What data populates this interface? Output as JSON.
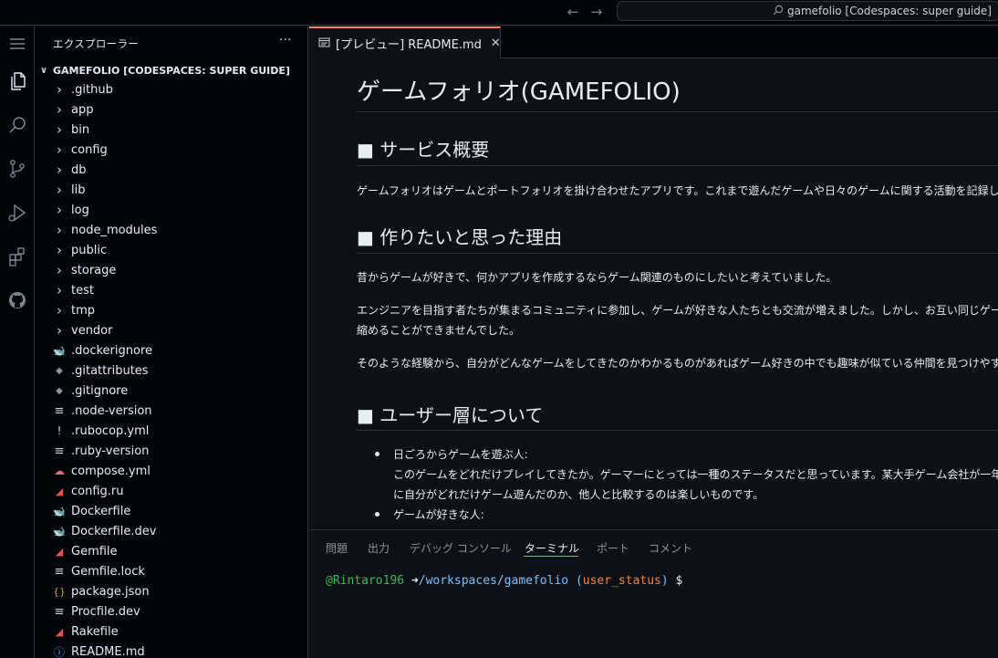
{
  "titlebar": {
    "back_icon": "arrow-left-icon",
    "forward_icon": "arrow-right-icon",
    "command_center": "gamefolio [Codespaces: super guide]"
  },
  "activitybar": {
    "items": [
      "explorer-icon",
      "search-icon",
      "source-control-icon",
      "run-debug-icon",
      "extensions-icon",
      "github-icon"
    ]
  },
  "sidebar": {
    "title": "エクスプローラー",
    "more": "···",
    "root": "GAMEFOLIO [CODESPACES: SUPER GUIDE]",
    "items": [
      {
        "name": ".github",
        "icon": ">"
      },
      {
        "name": "app",
        "icon": ">"
      },
      {
        "name": "bin",
        "icon": ">"
      },
      {
        "name": "config",
        "icon": ">"
      },
      {
        "name": "db",
        "icon": ">"
      },
      {
        "name": "lib",
        "icon": ">"
      },
      {
        "name": "log",
        "icon": ">"
      },
      {
        "name": "node_modules",
        "icon": ">"
      },
      {
        "name": "public",
        "icon": ">"
      },
      {
        "name": "storage",
        "icon": ">"
      },
      {
        "name": "test",
        "icon": ">"
      },
      {
        "name": "tmp",
        "icon": ">"
      },
      {
        "name": "vendor",
        "icon": ">"
      },
      {
        "name": ".dockerignore",
        "icon": "docker"
      },
      {
        "name": ".gitattributes",
        "icon": "git"
      },
      {
        "name": ".gitignore",
        "icon": "git"
      },
      {
        "name": ".node-version",
        "icon": "lines"
      },
      {
        "name": ".rubocop.yml",
        "icon": "!"
      },
      {
        "name": ".ruby-version",
        "icon": "lines"
      },
      {
        "name": "compose.yml",
        "icon": "compose"
      },
      {
        "name": "config.ru",
        "icon": "ruby"
      },
      {
        "name": "Dockerfile",
        "icon": "docker"
      },
      {
        "name": "Dockerfile.dev",
        "icon": "docker"
      },
      {
        "name": "Gemfile",
        "icon": "ruby"
      },
      {
        "name": "Gemfile.lock",
        "icon": "lines"
      },
      {
        "name": "package.json",
        "icon": "{}"
      },
      {
        "name": "Procfile.dev",
        "icon": "lines"
      },
      {
        "name": "Rakefile",
        "icon": "ruby"
      },
      {
        "name": "README.md",
        "icon": "info"
      }
    ]
  },
  "editor": {
    "tab_label": "[プレビュー] README.md",
    "tab_icon": "preview-icon",
    "tab_close": "✕",
    "preview": {
      "h1": "ゲームフォリオ(GAMEFOLIO)",
      "section1_title": "■ サービス概要",
      "section1_p": "ゲームフォリオはゲームとポートフォリオを掛け合わせたアプリです。これまで遊んだゲームや日々のゲームに関する活動を記録していくこと",
      "section2_title": "■ 作りたいと思った理由",
      "section2_p1": "昔からゲームが好きで、何かアプリを作成するならゲーム関連のものにしたいと考えていました。",
      "section2_p2_line1": "エンジニアを目指す者たちが集まるコミュニティに参加し、ゲームが好きな人たちとも交流が増えました。しかし、お互い同じゲームをプレ",
      "section2_p2_line2": "縮めることができませんでした。",
      "section2_p3": "そのような経験から、自分がどんなゲームをしてきたのかわかるものがあればゲーム好きの中でも趣味が似ている仲間を見つけやすくなる",
      "section3_title": "■ ユーザー層について",
      "li1_title": "日ごろからゲームを遊ぶ人:",
      "li1_line1": "このゲームをどれだけプレイしてきたか。ゲーマーにとっては一種のステータスだと思っています。某大手ゲーム会社が一年間最も遊",
      "li1_line2": "に自分がどれだけゲーム遊んだのか、他人と比較するのは楽しいものです。",
      "li2_title": "ゲームが好きな人:"
    }
  },
  "panel": {
    "tabs": [
      "問題",
      "出力",
      "デバッグ コンソール",
      "ターミナル",
      "ポート",
      "コメント"
    ],
    "active_tab": "ターミナル",
    "terminal": {
      "user": "@Rintaro196",
      "arrow": "➜",
      "path": "/workspaces/gamefolio",
      "paren_open": "(",
      "branch": "user_status",
      "paren_close": ")",
      "prompt": "$"
    }
  },
  "colors": {
    "background": "#0d1117",
    "sidebar": "#010409",
    "accent": "#f78166",
    "terminal_user": "#3fb950",
    "terminal_path": "#79c0ff",
    "terminal_branch": "#f0883e"
  }
}
